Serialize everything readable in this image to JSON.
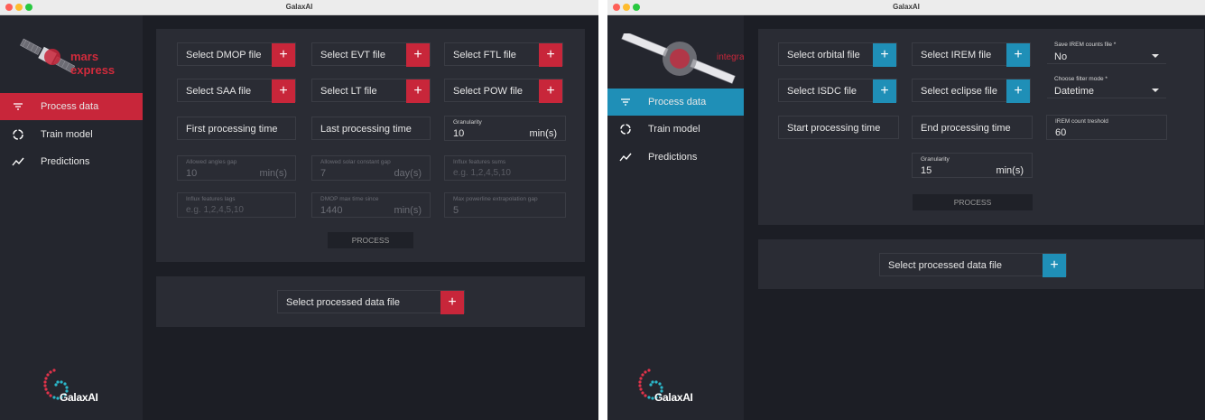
{
  "left": {
    "window_title": "GalaxAI",
    "logo_text": "mars express",
    "brand": "GalaxAI",
    "accent": "#c8263a",
    "nav": [
      {
        "label": "Process data",
        "icon": "filter-icon",
        "active": true
      },
      {
        "label": "Train model",
        "icon": "circle-dashed-icon",
        "active": false
      },
      {
        "label": "Predictions",
        "icon": "trend-line-icon",
        "active": false
      }
    ],
    "file_buttons": [
      "Select DMOP file",
      "Select EVT file",
      "Select FTL file",
      "Select SAA file",
      "Select LT file",
      "Select POW file"
    ],
    "first_processing_time": "First processing time",
    "last_processing_time": "Last processing time",
    "granularity": {
      "label": "Granularity",
      "value": "10",
      "unit": "min(s)"
    },
    "angles_gap": {
      "label": "Allowed angles gap",
      "value": "10",
      "unit": "min(s)"
    },
    "solar_gap": {
      "label": "Allowed solar constant gap",
      "value": "7",
      "unit": "day(s)"
    },
    "influx_sums": {
      "label": "Influx features sums",
      "placeholder": "e.g. 1,2,4,5,10"
    },
    "influx_lags": {
      "label": "Influx features lags",
      "placeholder": "e.g. 1,2,4,5,10"
    },
    "dmop_max": {
      "label": "DMOP max time since",
      "value": "1440",
      "unit": "min(s)"
    },
    "powerline": {
      "label": "Max powerline extrapolation gap",
      "value": "5"
    },
    "process_label": "PROCESS",
    "processed_file": "Select processed data file"
  },
  "right": {
    "window_title": "GalaxAI",
    "logo_text": "integral",
    "brand": "GalaxAI",
    "accent": "#1f8fb7",
    "nav": [
      {
        "label": "Process data",
        "icon": "filter-icon",
        "active": true
      },
      {
        "label": "Train model",
        "icon": "circle-dashed-icon",
        "active": false
      },
      {
        "label": "Predictions",
        "icon": "trend-line-icon",
        "active": false
      }
    ],
    "file_buttons": [
      "Select orbital file",
      "Select IREM file",
      "Select ISDC file",
      "Select eclipse file"
    ],
    "save_irem": {
      "label": "Save IREM counts file *",
      "value": "No"
    },
    "filter_mode": {
      "label": "Choose filter mode *",
      "value": "Datetime"
    },
    "start_processing_time": "Start processing time",
    "end_processing_time": "End processing time",
    "irem_threshold": {
      "label": "IREM count treshold",
      "value": "60"
    },
    "granularity": {
      "label": "Granularity",
      "value": "15",
      "unit": "min(s)"
    },
    "process_label": "PROCESS",
    "processed_file": "Select processed data file"
  }
}
